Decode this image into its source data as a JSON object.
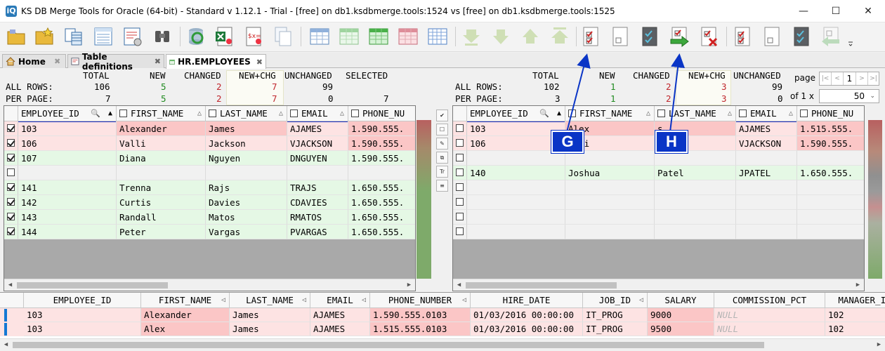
{
  "window": {
    "title": "KS DB Merge Tools for Oracle (64-bit) - Standard v 1.12.1 - Trial - [free] on db1.ksdbmerge.tools:1524 vs [free] on db1.ksdbmerge.tools:1525",
    "logo_text": "iQ",
    "minimize": "—",
    "maximize": "☐",
    "close": "✕"
  },
  "toolbar_icons": [
    "open-folder-icon",
    "folder-star-icon",
    "compare-tables-icon",
    "sql-query-icon",
    "report-settings-icon",
    "binoculars-icon",
    "refresh-icon",
    "excel-export-icon",
    "sql-script-icon",
    "copy-document-icon",
    "grid-view-icon",
    "grid-new-icon",
    "grid-green-icon",
    "grid-red-icon",
    "grid-blue-icon",
    "scroll-bottom-icon",
    "scroll-down-icon",
    "scroll-up-icon",
    "scroll-top-icon",
    "checklist-icon",
    "blank-doc-icon",
    "check-dark-icon",
    "merge-right-icon",
    "delete-selected-icon",
    "check-list-left-icon",
    "blank-doc-left-icon",
    "check-dark-left-icon",
    "merge-left-icon",
    "overflow-menu-icon"
  ],
  "tabs": [
    {
      "label": "Home",
      "close": "✖"
    },
    {
      "label": "Table definitions",
      "close": "✖"
    },
    {
      "label": "HR.EMPLOYEES",
      "close": "✖"
    }
  ],
  "left_stats": {
    "headers": [
      "TOTAL",
      "NEW",
      "CHANGED",
      "NEW+CHG",
      "UNCHANGED",
      "SELECTED"
    ],
    "all_label": "ALL  ROWS:",
    "page_label": "PER  PAGE:",
    "all": [
      "106",
      "5",
      "2",
      "7",
      "99",
      ""
    ],
    "page": [
      "7",
      "5",
      "2",
      "7",
      "0",
      "7"
    ]
  },
  "right_stats": {
    "headers": [
      "TOTAL",
      "NEW",
      "CHANGED",
      "NEW+CHG",
      "UNCHANGED"
    ],
    "all_label": "ALL  ROWS:",
    "page_label": "PER  PAGE:",
    "all": [
      "102",
      "1",
      "2",
      "3",
      "99"
    ],
    "page": [
      "3",
      "1",
      "2",
      "3",
      "0"
    ]
  },
  "pager": {
    "page_label": "page",
    "first": "|<",
    "prev": "<",
    "current": "1",
    "next": ">",
    "last": ">|",
    "of_label": "of 1 x",
    "page_size": "50"
  },
  "left_grid": {
    "columns": [
      "EMPLOYEE_ID",
      "FIRST_NAME",
      "LAST_NAME",
      "EMAIL",
      "PHONE_NU"
    ],
    "rows": [
      {
        "checked": true,
        "cells": [
          "103",
          "Alexander",
          "James",
          "AJAMES",
          "1.590.555."
        ],
        "type": "changed"
      },
      {
        "checked": true,
        "cells": [
          "106",
          "Valli",
          "Jackson",
          "VJACKSON",
          "1.590.555."
        ],
        "type": "changed"
      },
      {
        "checked": true,
        "cells": [
          "107",
          "Diana",
          "Nguyen",
          "DNGUYEN",
          "1.590.555."
        ],
        "type": "new"
      },
      {
        "checked": false,
        "cells": [
          "",
          "",
          "",
          "",
          ""
        ],
        "type": "empty"
      },
      {
        "checked": true,
        "cells": [
          "141",
          "Trenna",
          "Rajs",
          "TRAJS",
          "1.650.555."
        ],
        "type": "new"
      },
      {
        "checked": true,
        "cells": [
          "142",
          "Curtis",
          "Davies",
          "CDAVIES",
          "1.650.555."
        ],
        "type": "new"
      },
      {
        "checked": true,
        "cells": [
          "143",
          "Randall",
          "Matos",
          "RMATOS",
          "1.650.555."
        ],
        "type": "new"
      },
      {
        "checked": true,
        "cells": [
          "144",
          "Peter",
          "Vargas",
          "PVARGAS",
          "1.650.555."
        ],
        "type": "new"
      }
    ]
  },
  "right_grid": {
    "columns": [
      "EMPLOYEE_ID",
      "FIRST_NAME",
      "LAST_NAME",
      "EMAIL",
      "PHONE_NU"
    ],
    "rows": [
      {
        "checked": false,
        "cells": [
          "103",
          "Alex",
          "s",
          "AJAMES",
          "1.515.555."
        ],
        "type": "changed"
      },
      {
        "checked": false,
        "cells": [
          "106",
          "alli",
          "son",
          "VJACKSON",
          "1.590.555."
        ],
        "type": "changed"
      },
      {
        "checked": false,
        "cells": [
          "",
          "",
          "",
          "",
          ""
        ],
        "type": "empty"
      },
      {
        "checked": false,
        "cells": [
          "140",
          "Joshua",
          "Patel",
          "JPATEL",
          "1.650.555."
        ],
        "type": "new"
      },
      {
        "checked": false,
        "cells": [
          "",
          "",
          "",
          "",
          ""
        ],
        "type": "empty"
      },
      {
        "checked": false,
        "cells": [
          "",
          "",
          "",
          "",
          ""
        ],
        "type": "empty"
      },
      {
        "checked": false,
        "cells": [
          "",
          "",
          "",
          "",
          ""
        ],
        "type": "empty"
      },
      {
        "checked": false,
        "cells": [
          "",
          "",
          "",
          "",
          ""
        ],
        "type": "empty"
      }
    ]
  },
  "side_buttons": [
    "check-all-icon",
    "uncheck-icon",
    "edit-icon",
    "copy-icon",
    "text-icon",
    "list-icon"
  ],
  "side_labels": [
    "✔",
    "☐",
    "✎",
    "⧉",
    "Tr",
    "≡"
  ],
  "bottom_grid": {
    "columns": [
      "EMPLOYEE_ID",
      "FIRST_NAME",
      "LAST_NAME",
      "EMAIL",
      "PHONE_NUMBER",
      "HIRE_DATE",
      "JOB_ID",
      "SALARY",
      "COMMISSION_PCT",
      "MANAGER_ID"
    ],
    "rows": [
      [
        "103",
        "Alexander",
        "James",
        "AJAMES",
        "1.590.555.0103",
        "01/03/2016 00:00:00",
        "IT_PROG",
        "9000",
        "NULL",
        "102"
      ],
      [
        "103",
        "Alex",
        "James",
        "AJAMES",
        "1.515.555.0103",
        "01/03/2016 00:00:00",
        "IT_PROG",
        "9500",
        "NULL",
        "102"
      ]
    ]
  },
  "annotations": [
    "G",
    "H"
  ],
  "colors": {
    "changed_bg": "#fde3e3",
    "changed_cell": "#fbc6c6",
    "new_bg": "#e5f8e5",
    "empty_bg": "#f1f1f1",
    "new_text": "#1f8a1f",
    "changed_text": "#c0272d",
    "annotation": "#0a35c6"
  }
}
